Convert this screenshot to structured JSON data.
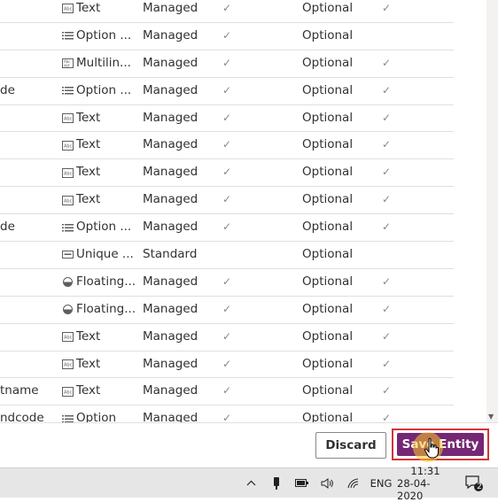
{
  "rows": [
    {
      "name": "",
      "type_icon": "text-icon",
      "type": "Text",
      "custom": "Managed",
      "searchable": "✓",
      "required": "Optional",
      "check2": "✓"
    },
    {
      "name": "",
      "type_icon": "option-set-icon",
      "type": "Option ...",
      "custom": "Managed",
      "searchable": "✓",
      "required": "Optional",
      "check2": ""
    },
    {
      "name": "",
      "type_icon": "multiline-text-icon",
      "type": "Multilin...",
      "custom": "Managed",
      "searchable": "✓",
      "required": "Optional",
      "check2": "✓"
    },
    {
      "name": "de",
      "type_icon": "option-set-icon",
      "type": "Option ...",
      "custom": "Managed",
      "searchable": "✓",
      "required": "Optional",
      "check2": "✓"
    },
    {
      "name": "",
      "type_icon": "text-icon",
      "type": "Text",
      "custom": "Managed",
      "searchable": "✓",
      "required": "Optional",
      "check2": "✓"
    },
    {
      "name": "",
      "type_icon": "text-icon",
      "type": "Text",
      "custom": "Managed",
      "searchable": "✓",
      "required": "Optional",
      "check2": "✓"
    },
    {
      "name": "",
      "type_icon": "text-icon",
      "type": "Text",
      "custom": "Managed",
      "searchable": "✓",
      "required": "Optional",
      "check2": "✓"
    },
    {
      "name": "",
      "type_icon": "text-icon",
      "type": "Text",
      "custom": "Managed",
      "searchable": "✓",
      "required": "Optional",
      "check2": "✓"
    },
    {
      "name": "de",
      "type_icon": "option-set-icon",
      "type": "Option ...",
      "custom": "Managed",
      "searchable": "✓",
      "required": "Optional",
      "check2": "✓"
    },
    {
      "name": "",
      "type_icon": "unique-identifier-icon",
      "type": "Unique ...",
      "custom": "Standard",
      "searchable": "",
      "required": "Optional",
      "check2": ""
    },
    {
      "name": "",
      "type_icon": "floating-point-icon",
      "type": "Floating...",
      "custom": "Managed",
      "searchable": "✓",
      "required": "Optional",
      "check2": "✓"
    },
    {
      "name": "",
      "type_icon": "floating-point-icon",
      "type": "Floating...",
      "custom": "Managed",
      "searchable": "✓",
      "required": "Optional",
      "check2": "✓"
    },
    {
      "name": "",
      "type_icon": "text-icon",
      "type": "Text",
      "custom": "Managed",
      "searchable": "✓",
      "required": "Optional",
      "check2": "✓"
    },
    {
      "name": "",
      "type_icon": "text-icon",
      "type": "Text",
      "custom": "Managed",
      "searchable": "✓",
      "required": "Optional",
      "check2": "✓"
    },
    {
      "name": "tname",
      "type_icon": "text-icon",
      "type": "Text",
      "custom": "Managed",
      "searchable": "✓",
      "required": "Optional",
      "check2": "✓"
    },
    {
      "name": "ndcode",
      "type_icon": "option-set-icon",
      "type": "Option",
      "custom": "Managed",
      "searchable": "✓",
      "required": "Optional",
      "check2": "✓"
    }
  ],
  "footer": {
    "discard_label": "Discard",
    "save_label": "Save Entity"
  },
  "taskbar": {
    "language": "ENG",
    "time": "11:31",
    "date": "28-04-2020",
    "notification_count": "2",
    "tray_icons": [
      "chevron-up-icon",
      "usb-icon",
      "battery-icon",
      "volume-icon",
      "wifi-icon"
    ]
  },
  "colors": {
    "save_button": "#742774",
    "highlight_border": "#d13438",
    "grid_line": "#e1dfdd",
    "check_color": "#8a8886"
  }
}
